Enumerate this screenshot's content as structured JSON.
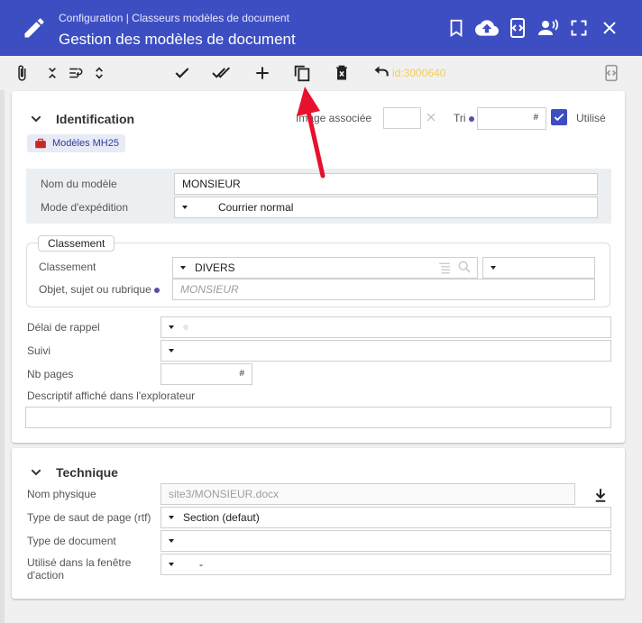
{
  "header": {
    "breadcrumb": "Configuration | Classeurs modèles de document",
    "title": "Gestion des modèles de document"
  },
  "toolbar": {
    "record_id": "id:3000640"
  },
  "identification": {
    "title": "Identification",
    "badge": "Modèles MH25",
    "image_label": "Image associée",
    "tri_label": "Tri",
    "utilise_label": "Utilisé",
    "utilise_checked": true,
    "nom_label": "Nom du modèle",
    "nom_value": "MONSIEUR",
    "mode_label": "Mode d'expédition",
    "mode_value": "Courrier normal",
    "classement_group": "Classement",
    "classement_label": "Classement",
    "classement_value": "DIVERS",
    "objet_label": "Objet, sujet ou rubrique",
    "objet_value": "MONSIEUR",
    "delai_label": "Délai de rappel",
    "suivi_label": "Suivi",
    "nbpages_label": "Nb pages",
    "hash": "#",
    "descriptif_label": "Descriptif affiché dans l'explorateur"
  },
  "technique": {
    "title": "Technique",
    "nom_physique_label": "Nom physique",
    "nom_physique_value": "site3/MONSIEUR.docx",
    "saut_label": "Type de saut de page (rtf)",
    "saut_value": "Section (defaut)",
    "type_doc_label": "Type de document",
    "utilise_fenetre_label": "Utilisé dans la fenêtre d'action",
    "utilise_fenetre_value": "-"
  },
  "colors": {
    "header_bg": "#3d4ec2",
    "accent": "#3d4ec2",
    "id_text": "#f2cd58",
    "arrow": "#e8112d"
  }
}
